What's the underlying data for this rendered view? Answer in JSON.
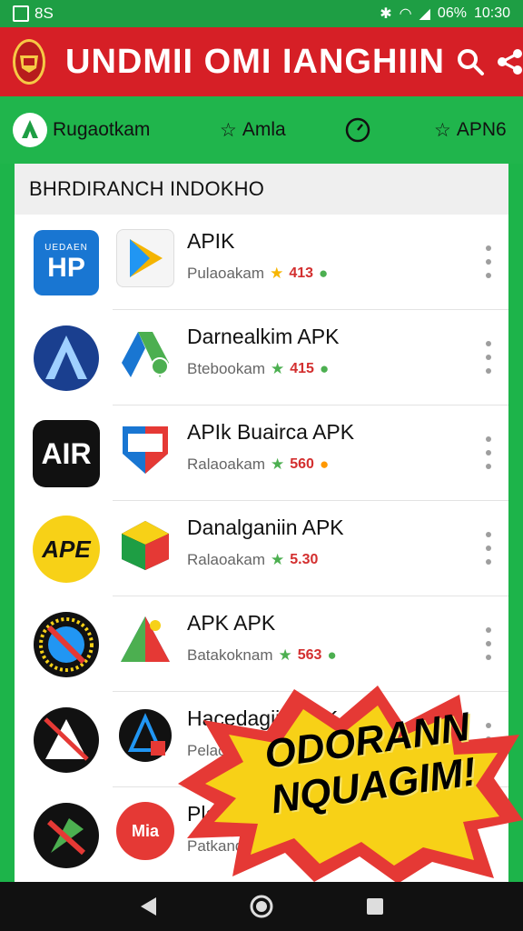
{
  "status_bar": {
    "left_text": "8S",
    "battery": "06%",
    "time": "10:30"
  },
  "app_bar": {
    "title": "UNDMII OMI IANGHIIN",
    "brand_color": "#d61f26",
    "icons": [
      "logo-crest",
      "search-icon",
      "share-icon"
    ]
  },
  "tabs": [
    {
      "label": "Rugaotkam",
      "icon": "tree-icon"
    },
    {
      "label": "Amla",
      "icon": "star-icon"
    },
    {
      "label": "",
      "icon": "clock-icon"
    },
    {
      "label": "APN6",
      "icon": "star-icon"
    }
  ],
  "section": {
    "title": "BHRDIRANCH INDOKHO"
  },
  "apps": [
    {
      "name": "APIK",
      "subtitle": "Pulaoakam",
      "rating": "413"
    },
    {
      "name": "Darnealkim APK",
      "subtitle": "Btebookam",
      "rating": "415"
    },
    {
      "name": "APIk Buairca APK",
      "subtitle": "Ralaoakam",
      "rating": "560"
    },
    {
      "name": "Danalganiin APK",
      "subtitle": "Ralaoakam",
      "rating": "5.30"
    },
    {
      "name": "APK APK",
      "subtitle": "Batakoknam",
      "rating": "563"
    },
    {
      "name": "Hacedagiin APK",
      "subtitle": "Pelaoakam",
      "rating": ""
    },
    {
      "name": "Plat...",
      "subtitle": "Patkandu",
      "rating": ""
    }
  ],
  "left_icons": [
    {
      "text": "HP",
      "small": "UEDAEN"
    },
    {
      "text": ""
    },
    {
      "text": "AIR"
    },
    {
      "text": "APE"
    },
    {
      "text": ""
    },
    {
      "text": ""
    },
    {
      "text": ""
    }
  ],
  "app_icon_text": {
    "row6": "Mia"
  },
  "promo": {
    "line1": "ODORANN",
    "line2": "NQUAGIM!"
  },
  "colors": {
    "green": "#1db44a",
    "red": "#d61f26",
    "yellow": "#f7d117"
  }
}
